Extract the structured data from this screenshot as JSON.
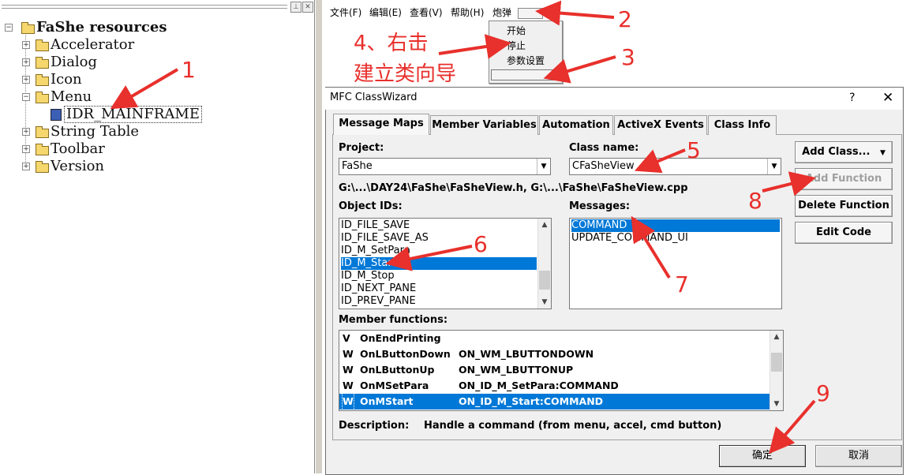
{
  "tree": {
    "root": "FaShe resources",
    "items": [
      {
        "label": "Accelerator",
        "expanded": false
      },
      {
        "label": "Dialog",
        "expanded": false
      },
      {
        "label": "Icon",
        "expanded": false
      },
      {
        "label": "Menu",
        "expanded": true
      },
      {
        "label": "String Table",
        "expanded": false
      },
      {
        "label": "Toolbar",
        "expanded": false
      },
      {
        "label": "Version",
        "expanded": false
      }
    ],
    "menu_child": "IDR_MAINFRAME"
  },
  "menubar": {
    "items": [
      "文件(F)",
      "编辑(E)",
      "查看(V)",
      "帮助(H)",
      "炮弹"
    ]
  },
  "dropdown": {
    "items": [
      "开始",
      "停止",
      "参数设置"
    ]
  },
  "annotations": {
    "step4_line1": "4、右击",
    "step4_line2": "建立类向导",
    "numbers": [
      "1",
      "2",
      "3",
      "5",
      "6",
      "7",
      "8",
      "9"
    ]
  },
  "dialog": {
    "title": "MFC ClassWizard",
    "help": "?",
    "close": "✕",
    "tabs": [
      "Message Maps",
      "Member Variables",
      "Automation",
      "ActiveX Events",
      "Class Info"
    ],
    "project_label": "Project:",
    "project_value": "FaShe",
    "classname_label": "Class name:",
    "classname_value": "CFaSheView",
    "path": "G:\\...\\DAY24\\FaShe\\FaSheView.h, G:\\...\\FaShe\\FaSheView.cpp",
    "object_ids_label": "Object IDs:",
    "object_ids": [
      "ID_FILE_SAVE",
      "ID_FILE_SAVE_AS",
      "ID_M_SetPara",
      "ID_M_Start",
      "ID_M_Stop",
      "ID_NEXT_PANE",
      "ID_PREV_PANE"
    ],
    "object_ids_selected": 3,
    "messages_label": "Messages:",
    "messages": [
      "COMMAND",
      "UPDATE_COMMAND_UI"
    ],
    "messages_selected": 0,
    "member_functions_label": "Member functions:",
    "member_functions": [
      {
        "mark": "V",
        "name": "OnEndPrinting",
        "handler": ""
      },
      {
        "mark": "W",
        "name": "OnLButtonDown",
        "handler": "ON_WM_LBUTTONDOWN"
      },
      {
        "mark": "W",
        "name": "OnLButtonUp",
        "handler": "ON_WM_LBUTTONUP"
      },
      {
        "mark": "W",
        "name": "OnMSetPara",
        "handler": "ON_ID_M_SetPara:COMMAND"
      },
      {
        "mark": "W",
        "name": "OnMStart",
        "handler": "ON_ID_M_Start:COMMAND"
      }
    ],
    "member_functions_selected": 4,
    "buttons": {
      "add_class": "Add Class...",
      "add_function": "Add Function",
      "delete_function": "Delete Function",
      "edit_code": "Edit Code",
      "ok": "确定",
      "cancel": "取消"
    },
    "description_label": "Description:",
    "description_value": "Handle a command (from menu, accel, cmd button)"
  },
  "colors": {
    "annotation": "#e8302c",
    "selection": "#0078d7"
  }
}
